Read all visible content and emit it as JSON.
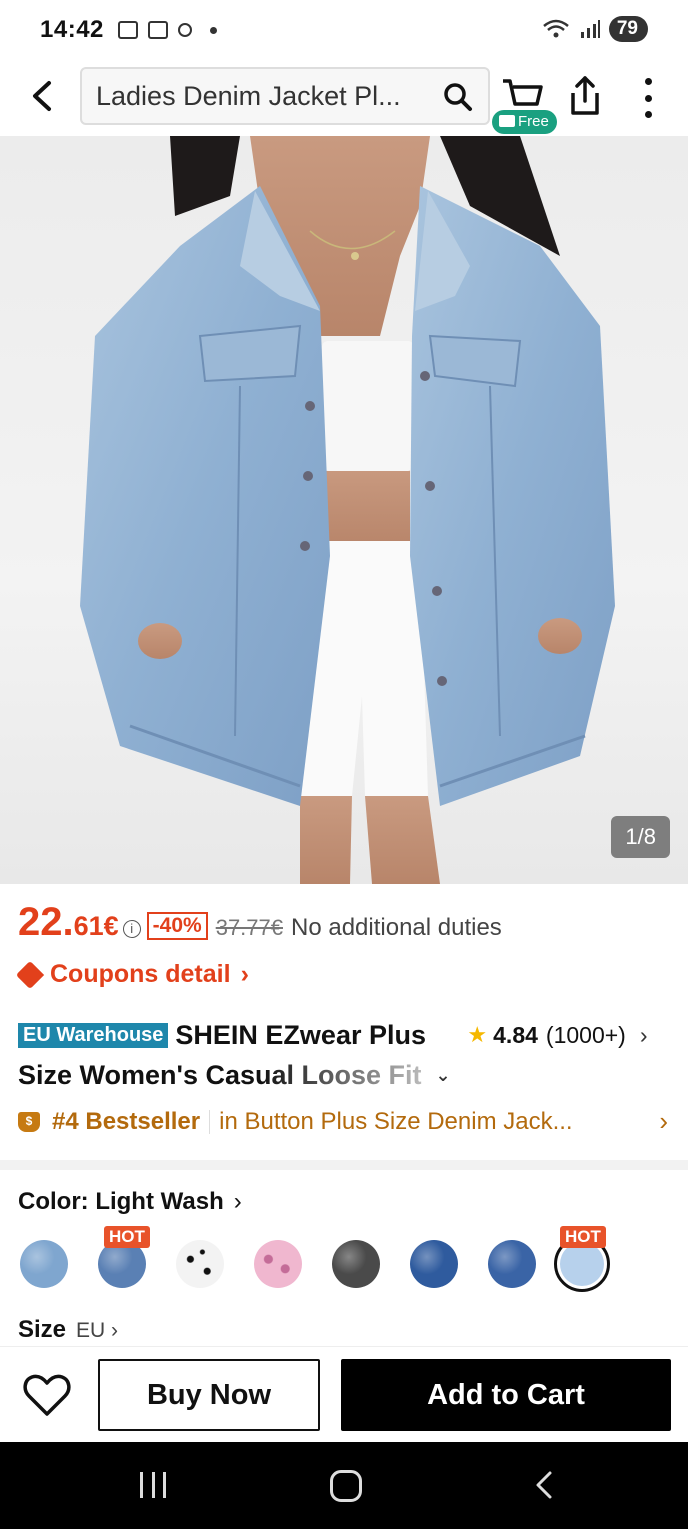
{
  "status_bar": {
    "time": "14:42",
    "battery": "79"
  },
  "top_nav": {
    "search_text": "Ladies Denim Jacket Pl...",
    "free_badge": "Free"
  },
  "gallery": {
    "counter": "1/8"
  },
  "price": {
    "main": "22.",
    "cents": "61€",
    "discount": "-40%",
    "original": "37.77€",
    "duties_note": "No additional duties"
  },
  "coupons": {
    "label": "Coupons detail",
    "chevron": "›"
  },
  "product": {
    "warehouse_badge": "EU Warehouse",
    "title_line1": "SHEIN EZwear Plus",
    "title_line2": "Size Women's Casual Loose Fit",
    "rating": "4.84",
    "review_count": "(1000+)",
    "rating_chevron": "›"
  },
  "bestseller": {
    "rank": "#4 Bestseller",
    "category": "in Button Plus Size Denim Jack...",
    "chevron": "›"
  },
  "color": {
    "label": "Color: Light Wash",
    "chevron": "›",
    "hot_label": "HOT",
    "swatches": [
      {
        "name": "light-wash",
        "hot": false,
        "color": "#7fa6cf"
      },
      {
        "name": "medium-wash",
        "hot": true,
        "color": "#5a80b4"
      },
      {
        "name": "white-black-dots",
        "hot": false,
        "color": "#f3f3f3"
      },
      {
        "name": "pink-leopard",
        "hot": false,
        "color": "#e8a8c4"
      },
      {
        "name": "black-wash",
        "hot": false,
        "color": "#4a4a4a"
      },
      {
        "name": "dark-blue",
        "hot": false,
        "color": "#2f5b9e"
      },
      {
        "name": "medium-blue",
        "hot": false,
        "color": "#3a64a6"
      },
      {
        "name": "ice-blue-selected",
        "hot": true,
        "color": "#b7d1ec"
      }
    ]
  },
  "size": {
    "label": "Size",
    "unit": "EU ›"
  },
  "actions": {
    "buy_now": "Buy Now",
    "add_to_cart": "Add to Cart"
  },
  "colors": {
    "accent": "#e2401b",
    "eu_badge": "#1e87ab",
    "free_badge": "#1aa080",
    "bestseller": "#b36a0d"
  }
}
